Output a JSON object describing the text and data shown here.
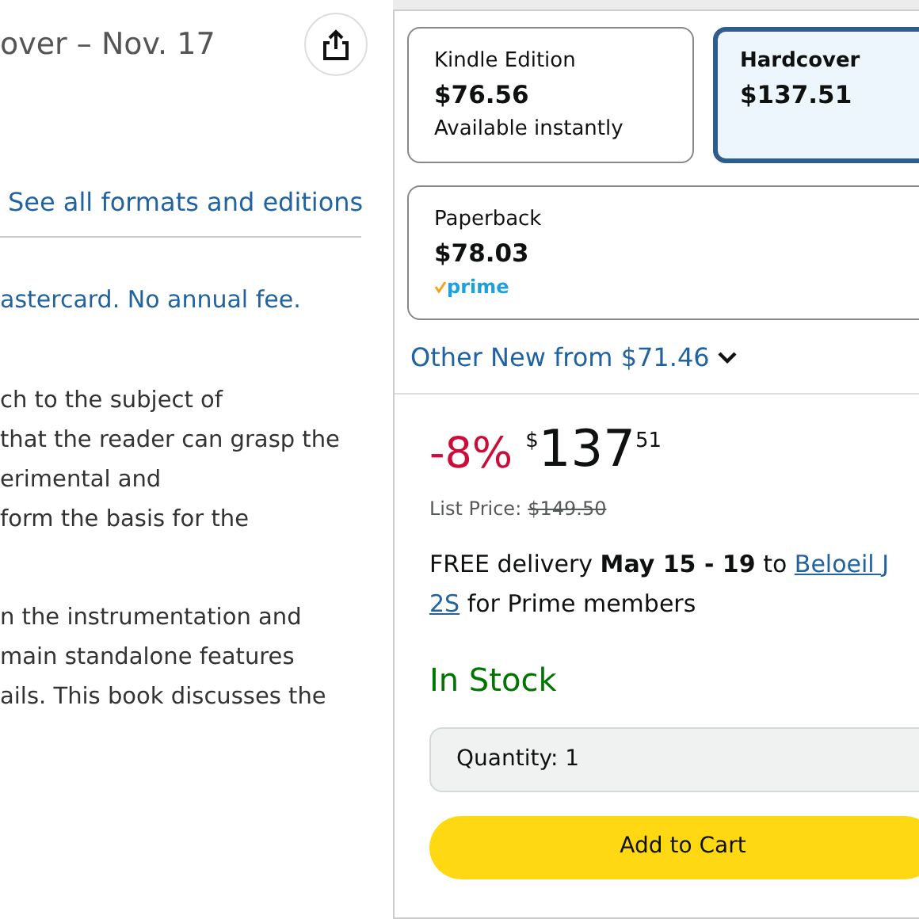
{
  "left": {
    "title": "over – Nov. 17",
    "formats_link": "See all formats and editions",
    "card_offer": "astercard. No annual fee.",
    "paragraphs": [
      [
        "ch to the subject of",
        "that the reader can grasp the",
        "erimental and",
        "form the basis for the"
      ],
      [
        "n the instrumentation and",
        "main standalone features",
        "ails. This book discusses the"
      ]
    ]
  },
  "formats": [
    {
      "name": "Kindle Edition",
      "price": "$76.56",
      "note": "Available instantly",
      "kind": "text",
      "selected": false
    },
    {
      "name": "Hardcover",
      "price": "$137.51",
      "kind": "none",
      "selected": true
    },
    {
      "name": "Paperback",
      "price": "$78.03",
      "note": "prime",
      "kind": "prime",
      "selected": false
    }
  ],
  "other_new": "Other New from $71.46",
  "buy_box": {
    "discount": "-8%",
    "currency": "$",
    "whole": "137",
    "fraction": "51",
    "list_price_label": "List Price:",
    "list_price": "$149.50",
    "delivery_prefix": "FREE delivery **May 15 - 19** to",
    "delivery_link": [
      "Beloeil J",
      "2S"
    ],
    "delivery_suffix": "for Prime members",
    "stock": "In Stock",
    "quantity": "Quantity: 1",
    "add_to_cart": "Add to Cart"
  }
}
